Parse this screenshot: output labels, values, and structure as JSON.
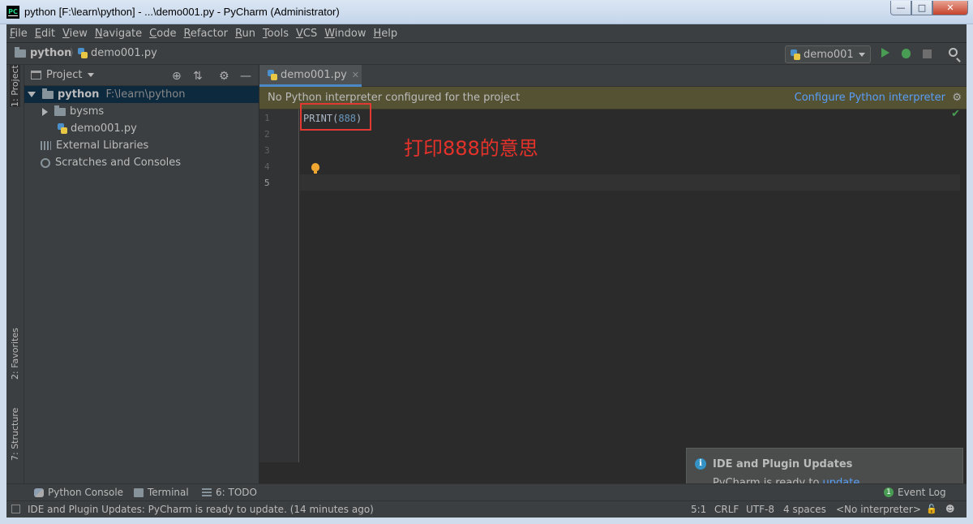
{
  "window": {
    "title": "python [F:\\learn\\python] - ...\\demo001.py - PyCharm (Administrator)",
    "app_icon_text": "PC",
    "buttons": [
      "minimize",
      "maximize",
      "close"
    ]
  },
  "menu": [
    "File",
    "Edit",
    "View",
    "Navigate",
    "Code",
    "Refactor",
    "Run",
    "Tools",
    "VCS",
    "Window",
    "Help"
  ],
  "breadcrumb": {
    "project": "python",
    "file": "demo001.py"
  },
  "run_config": "demo001",
  "side_tabs": {
    "project": "1: Project",
    "favorites": "2: Favorites",
    "structure": "7: Structure"
  },
  "project_panel": {
    "title": "Project",
    "tree": {
      "root": {
        "name": "python",
        "path": "F:\\learn\\python"
      },
      "folder": "bysms",
      "file": "demo001.py",
      "libraries": "External Libraries",
      "scratches": "Scratches and Consoles"
    }
  },
  "editor": {
    "tab": "demo001.py",
    "banner": {
      "message": "No Python interpreter configured for the project",
      "link": "Configure Python interpreter"
    },
    "line_numbers": [
      "1",
      "2",
      "3",
      "4",
      "5"
    ],
    "code": {
      "func": "PRINT(",
      "arg": "888",
      "close": ")"
    },
    "annotation": "打印888的意思"
  },
  "notification": {
    "title": "IDE and Plugin Updates",
    "body_prefix": "PyCharm is ready to ",
    "link": "update",
    "body_suffix": "."
  },
  "bottom_tools": {
    "python_console": "Python Console",
    "terminal": "Terminal",
    "todo": "6: TODO",
    "event_log": "Event Log",
    "event_count": "1"
  },
  "status": {
    "message": "IDE and Plugin Updates: PyCharm is ready to update. (14 minutes ago)",
    "position": "5:1",
    "line_sep": "CRLF",
    "encoding": "UTF-8",
    "indent": "4 spaces",
    "interpreter": "<No interpreter>"
  }
}
